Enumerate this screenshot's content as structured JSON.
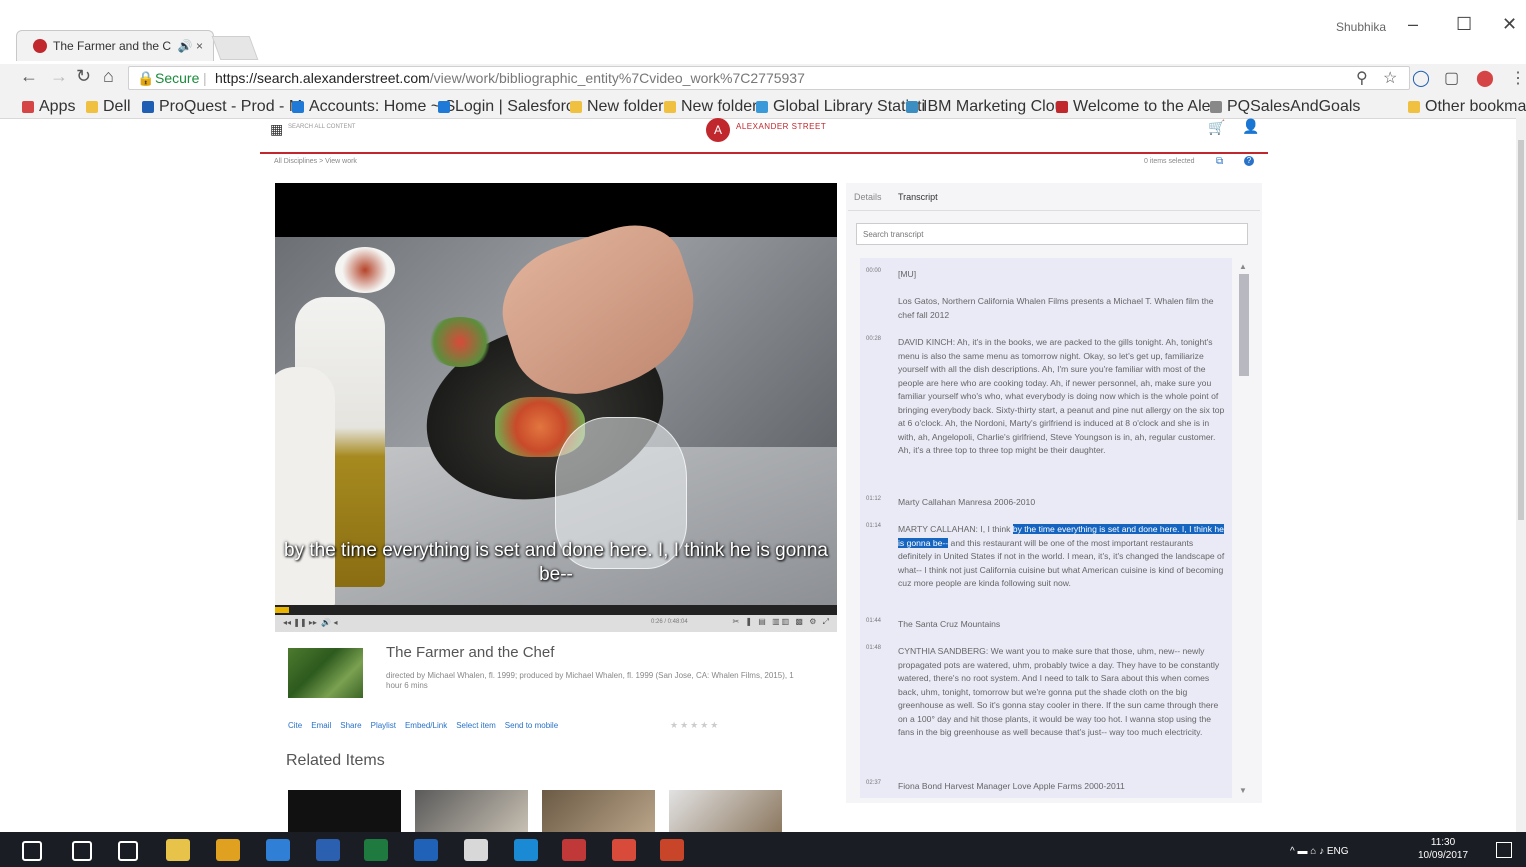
{
  "browser": {
    "tab_title": "The Farmer and the C",
    "tab_audio": "🔊",
    "tab_close": "×",
    "user_name": "Shubhika",
    "address": {
      "secure_label": "Secure",
      "url_host": "https://search.alexanderstreet.com",
      "url_path": "/view/work/bibliographic_entity%7Cvideo_work%7C2775937"
    },
    "bookmarks": [
      {
        "label": "Apps",
        "color": "#d64545"
      },
      {
        "label": "Dell",
        "color": "#f0c040"
      },
      {
        "label": "ProQuest - Prod - M",
        "color": "#1e5fb4"
      },
      {
        "label": "Accounts: Home ~ S",
        "color": "#1e7ad6"
      },
      {
        "label": "Login | Salesforce",
        "color": "#1e7ad6"
      },
      {
        "label": "New folder",
        "color": "#f0c040"
      },
      {
        "label": "New folder",
        "color": "#f0c040"
      },
      {
        "label": "Global Library Statisti",
        "color": "#3a9ad9"
      },
      {
        "label": "IBM Marketing Clou",
        "color": "#3b8ec2"
      },
      {
        "label": "Welcome to the Alex",
        "color": "#c0282d"
      },
      {
        "label": "PQSalesAndGoals",
        "color": "#888888"
      },
      {
        "label": "Other bookmarks",
        "color": "#f0c040"
      }
    ]
  },
  "page": {
    "search_all": "SEARCH ALL CONTENT",
    "logo_text": "ALEXANDER STREET",
    "breadcrumb": "All Disciplines  >  View work",
    "items_selected": "0 items selected",
    "tabs": [
      "Details",
      "Transcript"
    ],
    "transcript_search_placeholder": "Search transcript"
  },
  "video": {
    "caption": "by the time everything is set and done here. I, I think he is gonna be--",
    "time": "0:26 / 0:48:04",
    "progress_fraction": 0.025
  },
  "work": {
    "title": "The Farmer and the Chef",
    "meta": "directed by Michael Whalen, fl. 1999; produced by Michael Whalen, fl. 1999 (San Jose, CA: Whalen Films, 2015), 1 hour 6 mins",
    "actions": [
      "Cite",
      "Email",
      "Share",
      "Playlist",
      "Embed/Link",
      "Select item",
      "Send to mobile"
    ],
    "stars": "★★★★★",
    "related_heading": "Related Items"
  },
  "transcript": [
    {
      "ts": "00:00",
      "text": "[MU]"
    },
    {
      "ts": "",
      "text": "Los Gatos, Northern California Whalen Films presents a Michael T. Whalen film the chef fall 2012"
    },
    {
      "ts": "00:28",
      "text": "DAVID KINCH: Ah, it's in the books, we are packed to the gills tonight. Ah, tonight's menu is also the same menu as tomorrow night. Okay, so let's get up, familiarize yourself with all the dish descriptions. Ah, I'm sure you're familiar with most of the people are here who are cooking today. Ah, if newer personnel, ah, make sure you familiar yourself who's who, what everybody is doing now which is the whole point of bringing everybody back. Sixty-thirty start, a peanut and pine nut allergy on the six top at 6 o'clock. Ah, the Nordoni, Marty's girlfriend is induced at 8 o'clock and she is in with, ah, Angelopoli, Charlie's girlfriend, Steve Youngson is in, ah, regular customer. Ah, it's a three top to three top might be their daughter."
    },
    {
      "ts": "01:12",
      "text": "Marty Callahan Manresa 2006-2010"
    },
    {
      "ts": "01:14",
      "text_before": "MARTY CALLAHAN: I, I think ",
      "text_highlight": "by the time everything is set and done here. I, I think he is gonna be--",
      "text_after": " and this restaurant will be one of the most important restaurants definitely in United States if not in the world. I mean, it's, it's changed the landscape of what-- I think not just California cuisine but what American cuisine is kind of becoming cuz more people are kinda following suit now."
    },
    {
      "ts": "01:44",
      "text": "The Santa Cruz Mountains"
    },
    {
      "ts": "01:48",
      "text": "CYNTHIA SANDBERG: We want you to make sure that those, uhm, new-- newly propagated pots are watered, uhm, probably twice a day. They have to be constantly watered, there's no root system. And I need to talk to Sara about this when comes back, uhm, tonight, tomorrow but we're gonna put the shade cloth on the big greenhouse as well. So it's gonna stay cooler in there. If the sun came through there on a 100° day and hit those plants, it would be way too hot. I wanna stop using the fans in the big greenhouse as well because that's just-- way too much electricity."
    },
    {
      "ts": "02:37",
      "text": "Fiona Bond Harvest Manager Love Apple Farms 2000-2011"
    }
  ],
  "taskbar": {
    "tray": "^  ▬  ⌂  ♪  ENG",
    "time": "11:30",
    "date": "10/09/2017",
    "apps": [
      {
        "name": "windows-start",
        "color": "#ffffff"
      },
      {
        "name": "search",
        "color": "#ffffff"
      },
      {
        "name": "task-view",
        "color": "#ffffff"
      },
      {
        "name": "file-explorer",
        "color": "#e8c34a"
      },
      {
        "name": "chrome",
        "color": "#e0a020"
      },
      {
        "name": "internet-explorer",
        "color": "#2f7fd6"
      },
      {
        "name": "word",
        "color": "#2b5fb0"
      },
      {
        "name": "excel",
        "color": "#1f7a3f"
      },
      {
        "name": "outlook",
        "color": "#1f62b7"
      },
      {
        "name": "calculator",
        "color": "#d8d8d8"
      },
      {
        "name": "skype-business",
        "color": "#1a8ad4"
      },
      {
        "name": "skype",
        "color": "#c03838"
      },
      {
        "name": "app-red",
        "color": "#d84a3a"
      },
      {
        "name": "powerpoint",
        "color": "#c8452a"
      }
    ]
  },
  "colors": {
    "brand_red": "#c0282d",
    "link_blue": "#2a72c8",
    "highlight": "#1565c0"
  }
}
